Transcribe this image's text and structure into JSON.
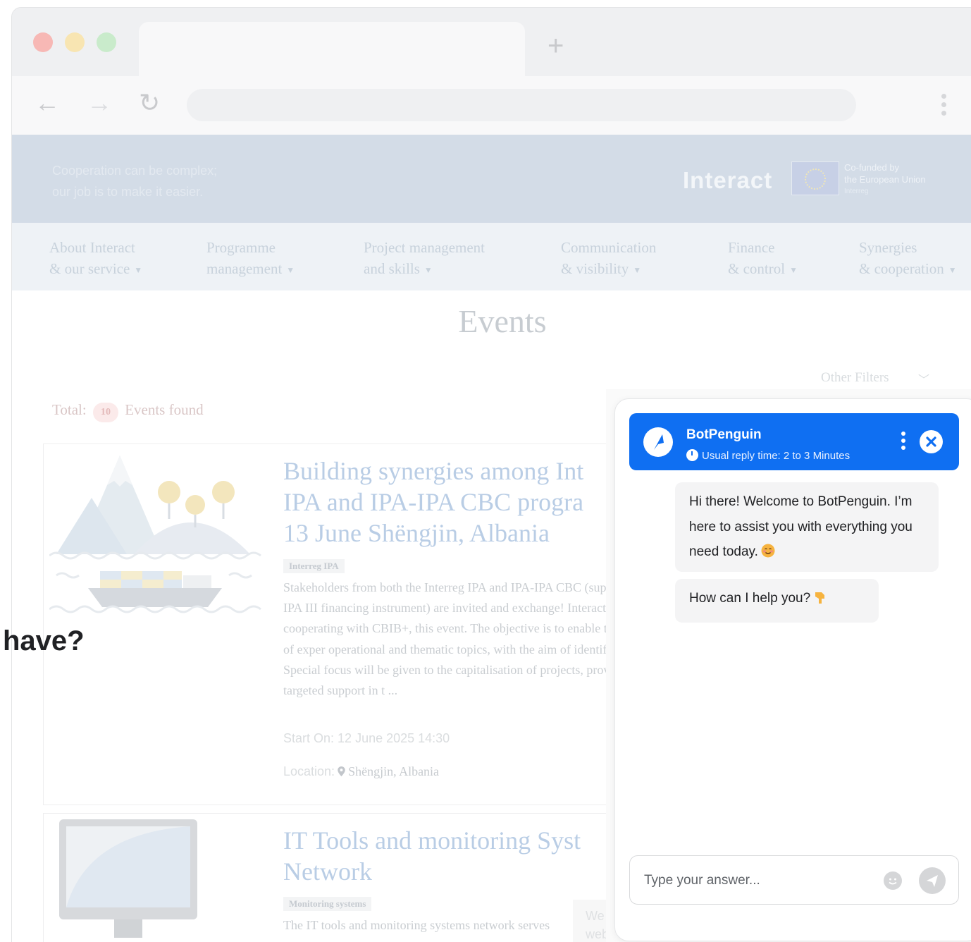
{
  "browser": {
    "new_tab_symbol": "+",
    "back_symbol": "←",
    "forward_symbol": "→",
    "reload_symbol": "↻"
  },
  "site": {
    "tagline_line1": "Cooperation can be complex;",
    "tagline_line2": "our job is to make it easier.",
    "brand": "Interact",
    "eu_line1": "Co-funded by",
    "eu_line2": "the European Union",
    "eu_line3": "Interreg"
  },
  "nav": [
    {
      "line1": "About Interact",
      "line2": "& our service"
    },
    {
      "line1": "Programme",
      "line2": "management"
    },
    {
      "line1": "Project management",
      "line2": "and skills"
    },
    {
      "line1": "Communication",
      "line2": "& visibility"
    },
    {
      "line1": "Finance",
      "line2": "& control"
    },
    {
      "line1": "Synergies",
      "line2": "& cooperation"
    }
  ],
  "events": {
    "page_title": "Events",
    "filters_label": "Other Filters",
    "total_label": "Total:",
    "total_count": "10",
    "found_label": "Events found",
    "items": [
      {
        "title_line1": "Building synergies among Int",
        "title_line2": "IPA and IPA-IPA CBC progra",
        "title_line3": "13 June Shëngjin, Albania",
        "tag": "Interreg IPA",
        "description": "Stakeholders from both the Interreg IPA and IPA-IPA CBC (supported by the IPA III financing instrument) are invited and exchange! Interact is closely cooperating with CBIB+, this event. The objective is to enable the exchange of exper operational and thematic topics, with the aim of identifyin synergy. Special focus will be given to the capitalisation of projects, providing targeted support in t ...",
        "start_label": "Start On:",
        "start_value": "12 June 2025 14:30",
        "location_label": "Location:",
        "location_value": "Shëngjin, Albania"
      },
      {
        "title_line1": "IT Tools and monitoring Syst",
        "title_line2": "Network",
        "tag": "Monitoring systems",
        "description": "The IT tools and monitoring systems network serves"
      }
    ]
  },
  "cookie_snippet": {
    "line1": "We",
    "line2": "web"
  },
  "stray_text": "have?",
  "chatbot": {
    "name": "BotPenguin",
    "reply_time": "Usual reply time: 2 to 3 Minutes",
    "accent": "#0f6ff2",
    "messages": [
      "Hi there! Welcome to BotPenguin. I’m here to assist you with everything you need today.",
      "How can I help you?"
    ],
    "input_placeholder": "Type your answer..."
  }
}
